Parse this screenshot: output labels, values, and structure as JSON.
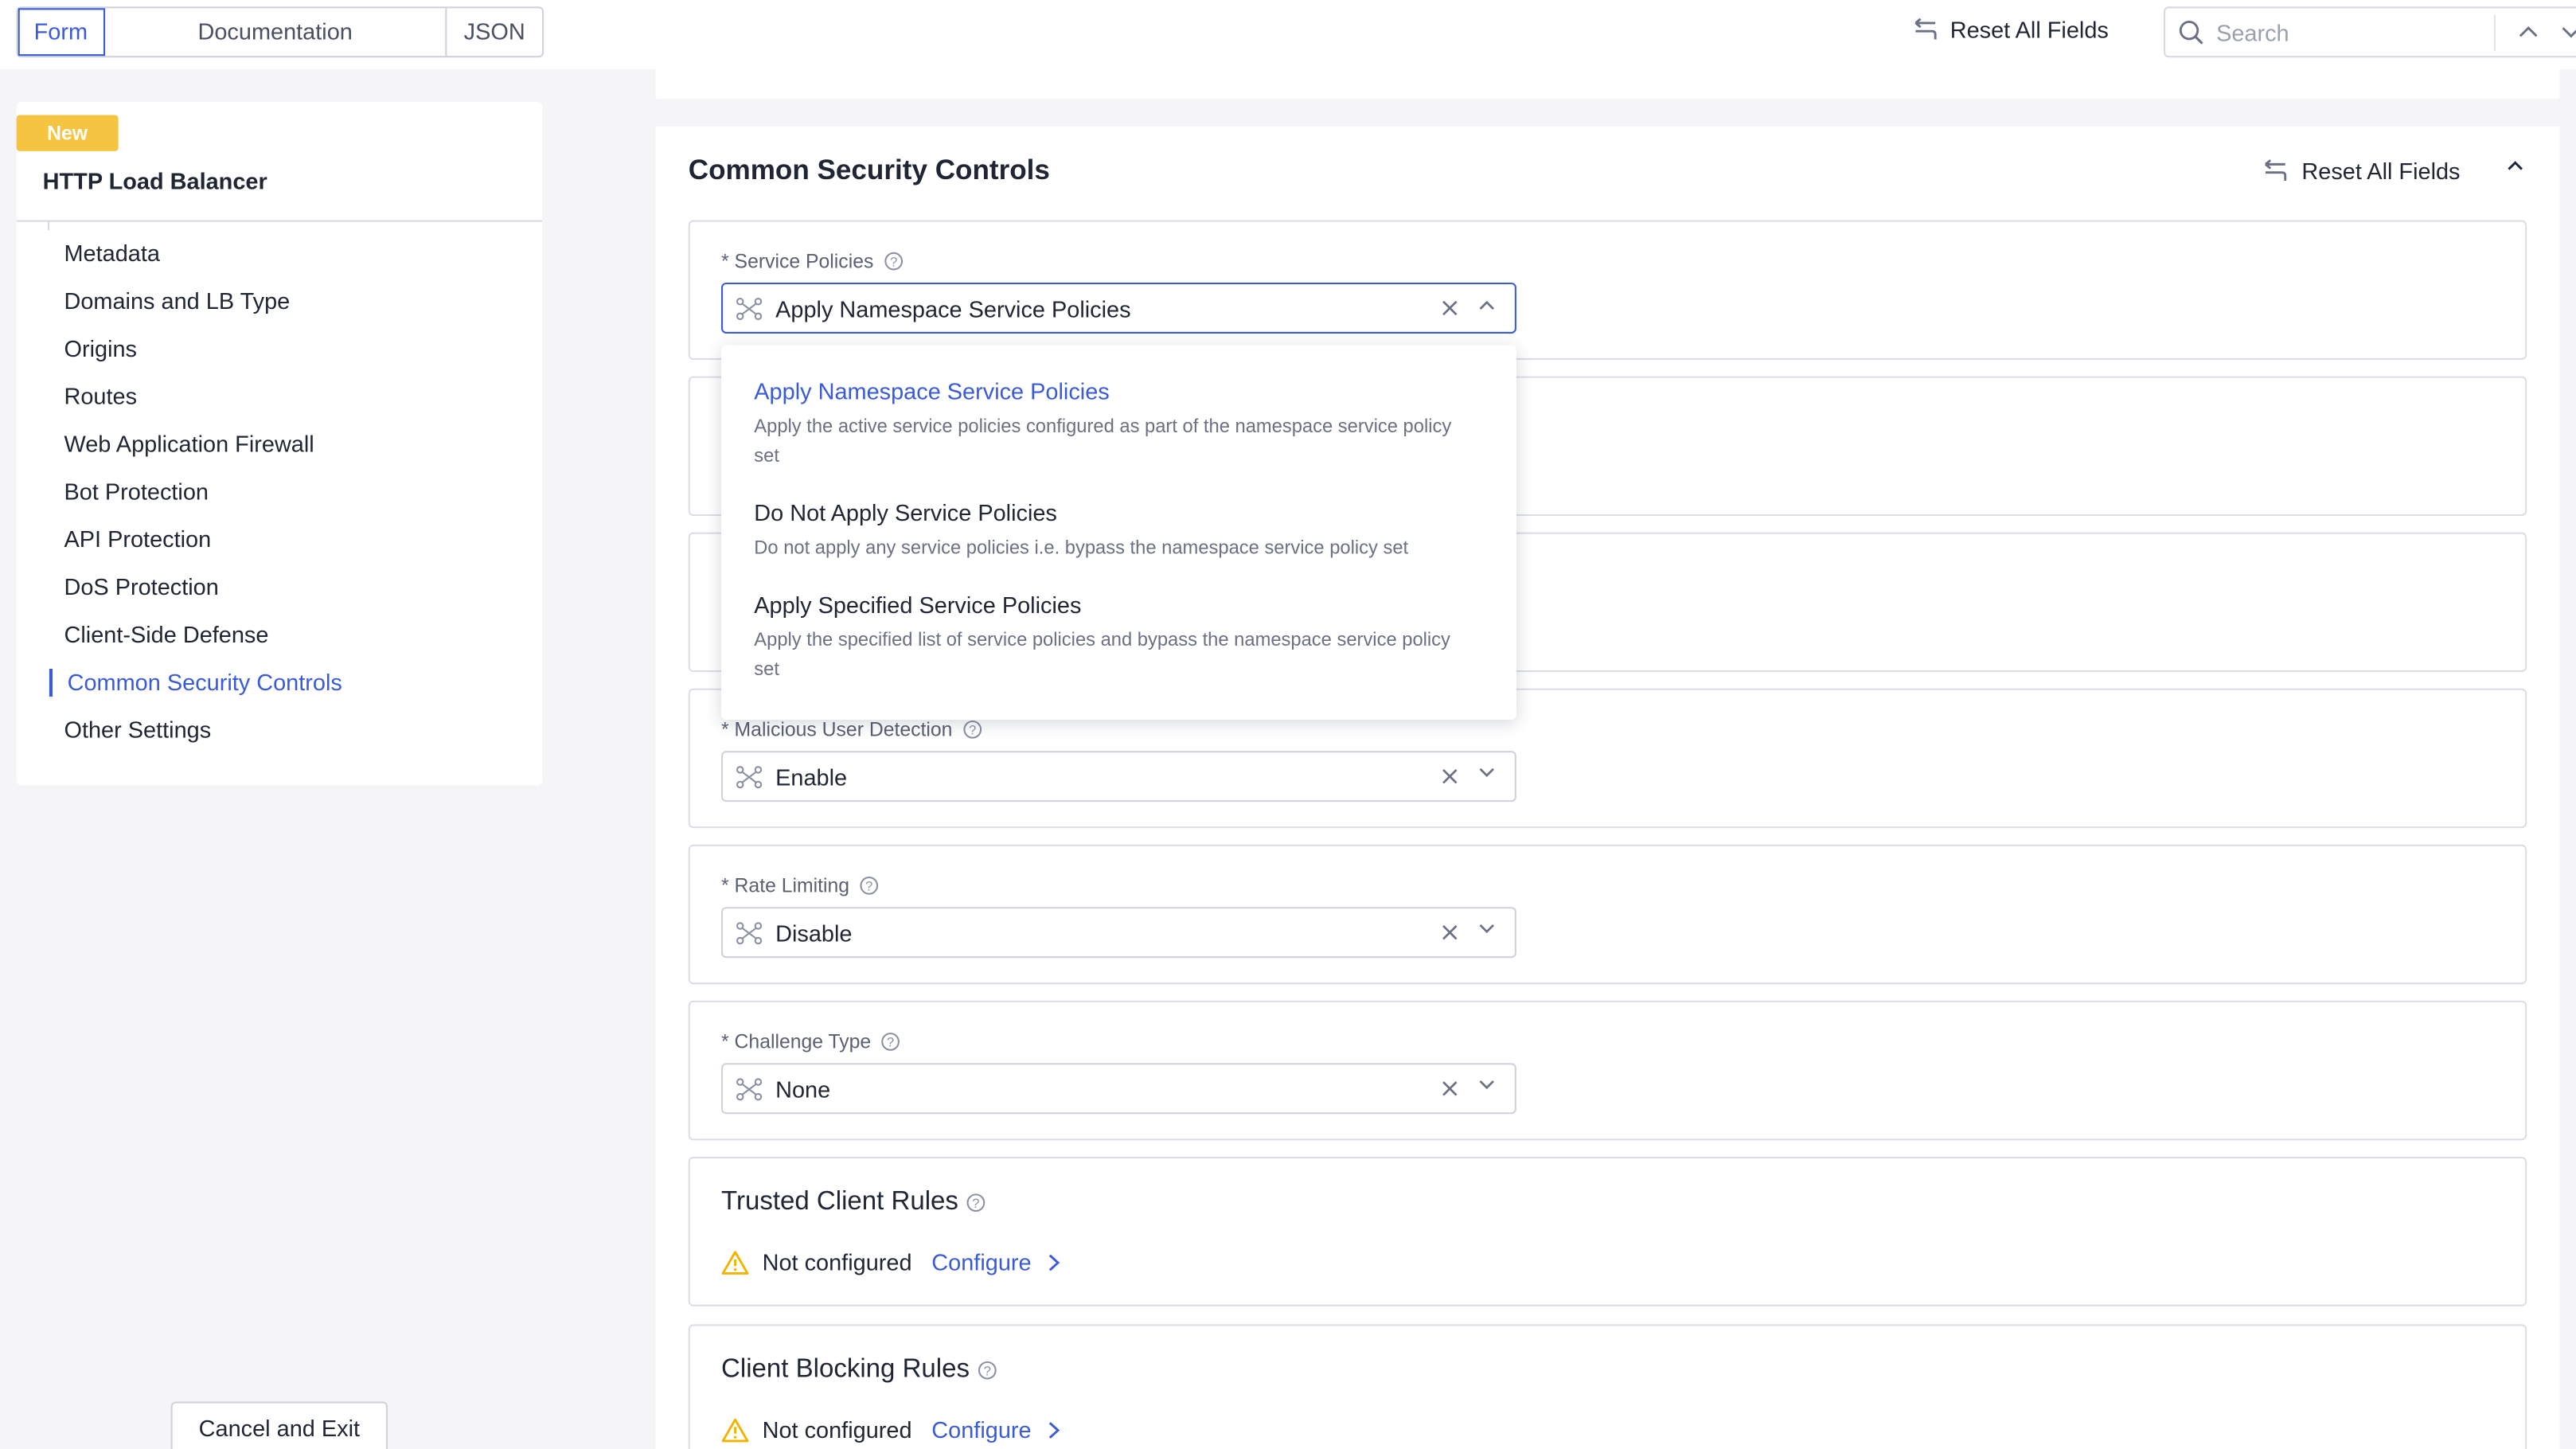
{
  "topbar": {
    "tabs": [
      "Form",
      "Documentation",
      "JSON"
    ],
    "active_tab": "Form",
    "reset_label": "Reset All Fields",
    "search_placeholder": "Search"
  },
  "sidebar": {
    "badge": "New",
    "title": "HTTP Load Balancer",
    "items": [
      {
        "label": "Metadata"
      },
      {
        "label": "Domains and LB Type"
      },
      {
        "label": "Origins"
      },
      {
        "label": "Routes"
      },
      {
        "label": "Web Application Firewall"
      },
      {
        "label": "Bot Protection"
      },
      {
        "label": "API Protection"
      },
      {
        "label": "DoS Protection"
      },
      {
        "label": "Client-Side Defense"
      },
      {
        "label": "Common Security Controls",
        "active": true
      },
      {
        "label": "Other Settings"
      }
    ],
    "cancel_label": "Cancel and Exit"
  },
  "section": {
    "title": "Common Security Controls",
    "reset_label": "Reset All Fields",
    "fields": {
      "service_policies": {
        "label": "Service Policies",
        "value": "Apply Namespace Service Policies"
      },
      "malicious_user_detection": {
        "label": "Malicious User Detection",
        "value": "Enable"
      },
      "rate_limiting": {
        "label": "Rate Limiting",
        "value": "Disable"
      },
      "challenge_type": {
        "label": "Challenge Type",
        "value": "None"
      }
    },
    "dropdown": {
      "options": [
        {
          "title": "Apply Namespace Service Policies",
          "desc": "Apply the active service policies configured as part of the namespace service policy set",
          "selected": true
        },
        {
          "title": "Do Not Apply Service Policies",
          "desc": "Do not apply any service policies i.e. bypass the namespace service policy set"
        },
        {
          "title": "Apply Specified Service Policies",
          "desc": "Apply the specified list of service policies and bypass the namespace service policy set"
        }
      ]
    },
    "trusted_client_rules": {
      "title": "Trusted Client Rules",
      "status": "Not configured",
      "action": "Configure"
    },
    "client_blocking_rules": {
      "title": "Client Blocking Rules",
      "status": "Not configured",
      "action": "Configure"
    }
  },
  "colors": {
    "accent": "#3a5bd9",
    "badge": "#f5c542",
    "warning": "#f0b400"
  },
  "icons": [
    "undo-icon",
    "search-icon",
    "chevron-up-icon",
    "chevron-down-icon",
    "help-icon",
    "policy-icon",
    "clear-icon",
    "warning-icon",
    "chevron-right-icon"
  ]
}
